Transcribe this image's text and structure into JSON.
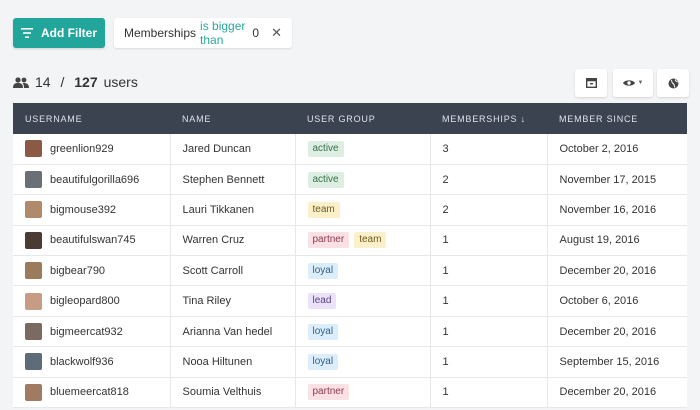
{
  "toolbar": {
    "add_filter_label": "Add Filter",
    "filter": {
      "field": "Memberships",
      "operator": "is bigger than",
      "value": "0"
    }
  },
  "summary": {
    "shown": "14",
    "separator": " / ",
    "total": "127",
    "unit": "users"
  },
  "table": {
    "headers": {
      "username": "USERNAME",
      "name": "NAME",
      "group": "USER GROUP",
      "memberships": "MEMBERSHIPS ↓",
      "since": "MEMBER SINCE"
    },
    "rows": [
      {
        "username": "greenlion929",
        "name": "Jared Duncan",
        "tags": [
          "active"
        ],
        "memberships": "3",
        "since": "October 2, 2016"
      },
      {
        "username": "beautifulgorilla696",
        "name": "Stephen Bennett",
        "tags": [
          "active"
        ],
        "memberships": "2",
        "since": "November 17, 2015"
      },
      {
        "username": "bigmouse392",
        "name": "Lauri Tikkanen",
        "tags": [
          "team"
        ],
        "memberships": "2",
        "since": "November 16, 2016"
      },
      {
        "username": "beautifulswan745",
        "name": "Warren Cruz",
        "tags": [
          "partner",
          "team"
        ],
        "memberships": "1",
        "since": "August 19, 2016"
      },
      {
        "username": "bigbear790",
        "name": "Scott Carroll",
        "tags": [
          "loyal"
        ],
        "memberships": "1",
        "since": "December 20, 2016"
      },
      {
        "username": "bigleopard800",
        "name": "Tina Riley",
        "tags": [
          "lead"
        ],
        "memberships": "1",
        "since": "October 6, 2016"
      },
      {
        "username": "bigmeercat932",
        "name": "Arianna Van hedel",
        "tags": [
          "loyal"
        ],
        "memberships": "1",
        "since": "December 20, 2016"
      },
      {
        "username": "blackwolf936",
        "name": "Nooa Hiltunen",
        "tags": [
          "loyal"
        ],
        "memberships": "1",
        "since": "September 15, 2016"
      },
      {
        "username": "bluemeercat818",
        "name": "Soumia Velthuis",
        "tags": [
          "partner"
        ],
        "memberships": "1",
        "since": "December 20, 2016"
      }
    ]
  },
  "tag_colors": {
    "active": {
      "bg": "#dcefe2",
      "fg": "#3a6e4b"
    },
    "team": {
      "bg": "#fbf0c9",
      "fg": "#6b5a1e"
    },
    "partner": {
      "bg": "#fbe0e6",
      "fg": "#8a3a4f"
    },
    "loyal": {
      "bg": "#dceefb",
      "fg": "#2f5f86"
    },
    "lead": {
      "bg": "#ebe2fa",
      "fg": "#5a3f86"
    }
  },
  "colors": {
    "accent": "#22a59a",
    "header_bg": "#3b4351",
    "page_bg": "#f3f4f5"
  },
  "icons": [
    "filter-lines-icon",
    "close-icon",
    "users-icon",
    "archive-icon",
    "eye-icon",
    "globe-icon",
    "avatar"
  ]
}
